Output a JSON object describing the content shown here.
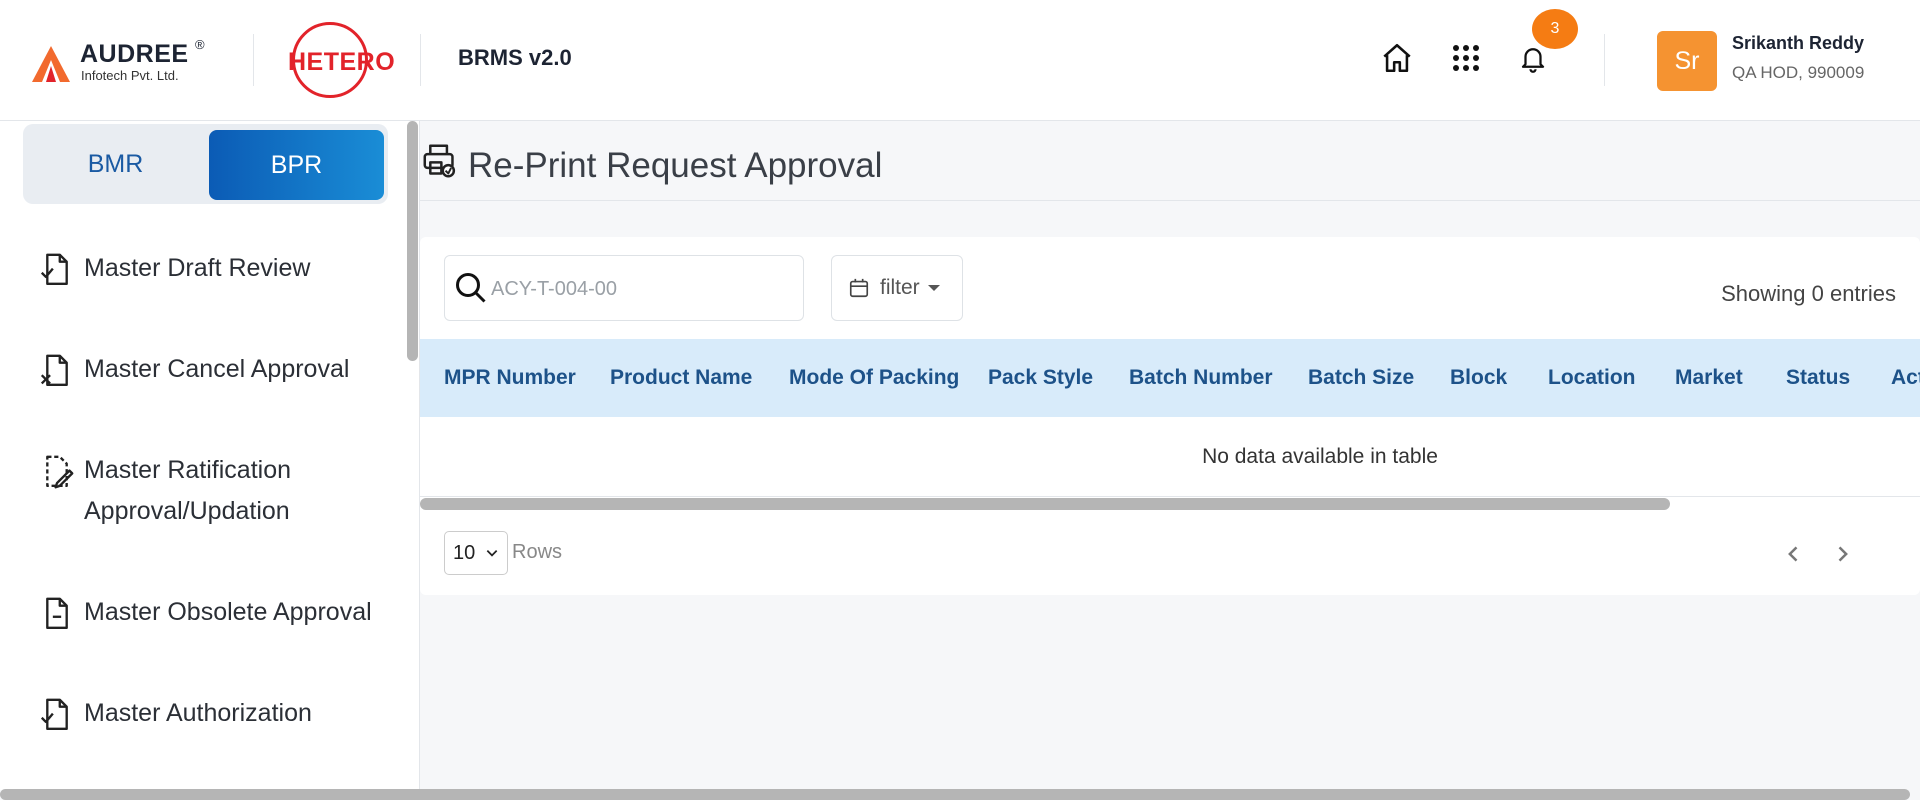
{
  "header": {
    "company_name": "AUDREE",
    "company_reg": "®",
    "company_sub": "Infotech Pvt. Ltd.",
    "client_logo_text": "HETERO",
    "app_name": "BRMS v2.0",
    "notification_count": "3",
    "user": {
      "initials": "Sr",
      "name": "Srikanth Reddy",
      "role": "QA HOD, 990009"
    },
    "icons": [
      "home-icon",
      "apps-grid-icon",
      "bell-icon"
    ],
    "colors": {
      "accent": "#f57c13",
      "avatar": "#f59331",
      "brand_red": "#e2232a"
    }
  },
  "sidebar": {
    "toggle": {
      "bmr": "BMR",
      "bpr": "BPR",
      "active": "BPR"
    },
    "items": [
      {
        "label": "Master Draft Review",
        "icon": "doc-check-icon"
      },
      {
        "label": "Master Cancel Approval",
        "icon": "doc-x-icon"
      },
      {
        "label": "Master Ratification Approval/Updation",
        "line1": "Master Ratification",
        "line2": "Approval/Updation",
        "icon": "doc-edit-icon"
      },
      {
        "label": "Master Obsolete Approval",
        "icon": "doc-minus-icon"
      },
      {
        "label": "Master Authorization",
        "icon": "doc-check-icon"
      }
    ]
  },
  "main": {
    "title": "Re-Print Request Approval",
    "title_icon": "printer-icon",
    "search": {
      "placeholder": "ACY-T-004-00",
      "value": ""
    },
    "filter_label": "filter",
    "showing": "Showing 0 entries",
    "table": {
      "columns": [
        "MPR Number",
        "Product Name",
        "Mode Of Packing",
        "Pack Style",
        "Batch Number",
        "Batch Size",
        "Block",
        "Location",
        "Market",
        "Status",
        "Action"
      ],
      "empty_text": "No data available in table"
    },
    "rows_per_page": "10",
    "rows_label": "Rows"
  }
}
